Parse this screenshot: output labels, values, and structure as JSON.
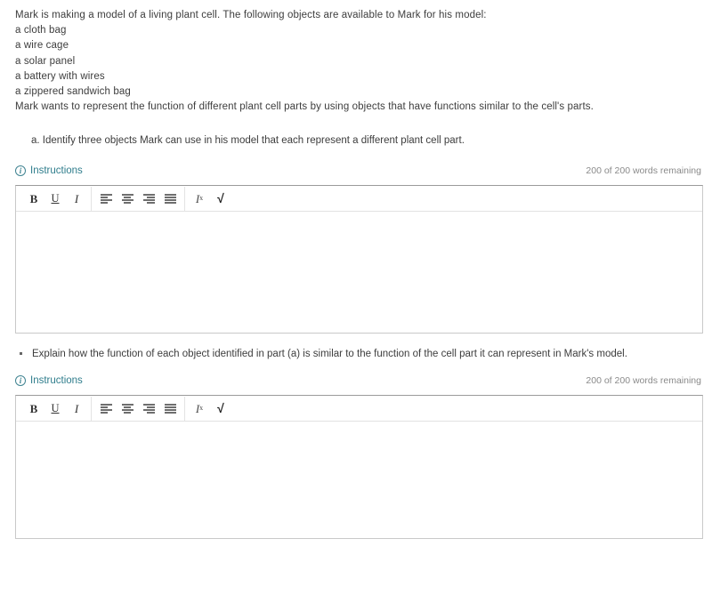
{
  "question": {
    "stem_lines": [
      "Mark is making a model of a living plant cell. The following objects are available to Mark for his model:",
      "a cloth bag",
      "a wire cage",
      "a solar panel",
      "a battery with wires",
      "a zippered sandwich bag",
      "Mark wants to represent the function of different plant cell parts by using objects that have functions similar to the cell's parts."
    ],
    "part_a": "a. Identify three objects Mark can use in his model that each represent a different plant cell part.",
    "part_b": "Explain how the function of each object identified in part (a) is similar to the function of the cell part it can represent in Mark's model."
  },
  "instructions": {
    "label": "Instructions",
    "icon": "info-circle-icon"
  },
  "word_counter": {
    "text": "200 of 200 words remaining",
    "remaining": 200,
    "limit": 200
  },
  "toolbar": {
    "bold": "B",
    "underline": "U",
    "italic": "I",
    "align_left": "align-left-icon",
    "align_center": "align-center-icon",
    "align_right": "align-right-icon",
    "align_justify": "align-justify-icon",
    "remove_format": "I",
    "remove_format_sub": "x",
    "math": "√"
  },
  "answers": {
    "a_value": "",
    "b_value": "",
    "placeholder": ""
  },
  "colors": {
    "link_teal": "#2f7d8c",
    "text": "#3d3d3d",
    "muted": "#8a8a8a",
    "border": "#c9c9c9",
    "border_top": "#9b9b9b"
  }
}
